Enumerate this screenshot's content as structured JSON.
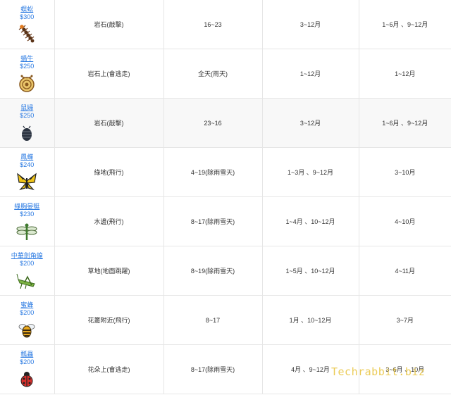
{
  "rows": [
    {
      "name": "蜈蚣",
      "price": "$300",
      "icon": "centipede-icon",
      "location": "岩石(敲擊)",
      "time": "16~23",
      "north": "3~12月",
      "south": "1~6月 、9~12月"
    },
    {
      "name": "蝸牛",
      "price": "$250",
      "icon": "snail-icon",
      "location": "岩石上(會逃走)",
      "time": "全天(雨天)",
      "north": "1~12月",
      "south": "1~12月"
    },
    {
      "name": "鼠婦",
      "price": "$250",
      "icon": "pill-bug-icon",
      "location": "岩石(敲擊)",
      "time": "23~16",
      "north": "3~12月",
      "south": "1~6月 、9~12月"
    },
    {
      "name": "鳳蝶",
      "price": "$240",
      "icon": "butterfly-icon",
      "location": "綠地(飛行)",
      "time": "4~19(除雨雪天)",
      "north": "1~3月 、9~12月",
      "south": "3~10月"
    },
    {
      "name": "綠胸晏蜓",
      "price": "$230",
      "icon": "dragonfly-icon",
      "location": "水邊(飛行)",
      "time": "8~17(除雨雪天)",
      "north": "1~4月 、10~12月",
      "south": "4~10月"
    },
    {
      "name": "中華劍角蝗",
      "price": "$200",
      "icon": "grasshopper-icon",
      "location": "草地(地面跳躍)",
      "time": "8~19(除雨雪天)",
      "north": "1~5月 、10~12月",
      "south": "4~11月"
    },
    {
      "name": "蜜蜂",
      "price": "$200",
      "icon": "honeybee-icon",
      "location": "花叢附近(飛行)",
      "time": "8~17",
      "north": "1月 、10~12月",
      "south": "3~7月"
    },
    {
      "name": "瓢蟲",
      "price": "$200",
      "icon": "ladybug-icon",
      "location": "花朵上(會逃走)",
      "time": "8~17(除雨雪天)",
      "north": "4月 、9~12月",
      "south": "3~6月 、10月"
    }
  ],
  "watermark": "Techrabbit.biz",
  "colors": {
    "link": "#2a7ae2",
    "border": "#e6e6e6",
    "alt_row": "#f8f8f8",
    "watermark": "#e8c33a"
  }
}
